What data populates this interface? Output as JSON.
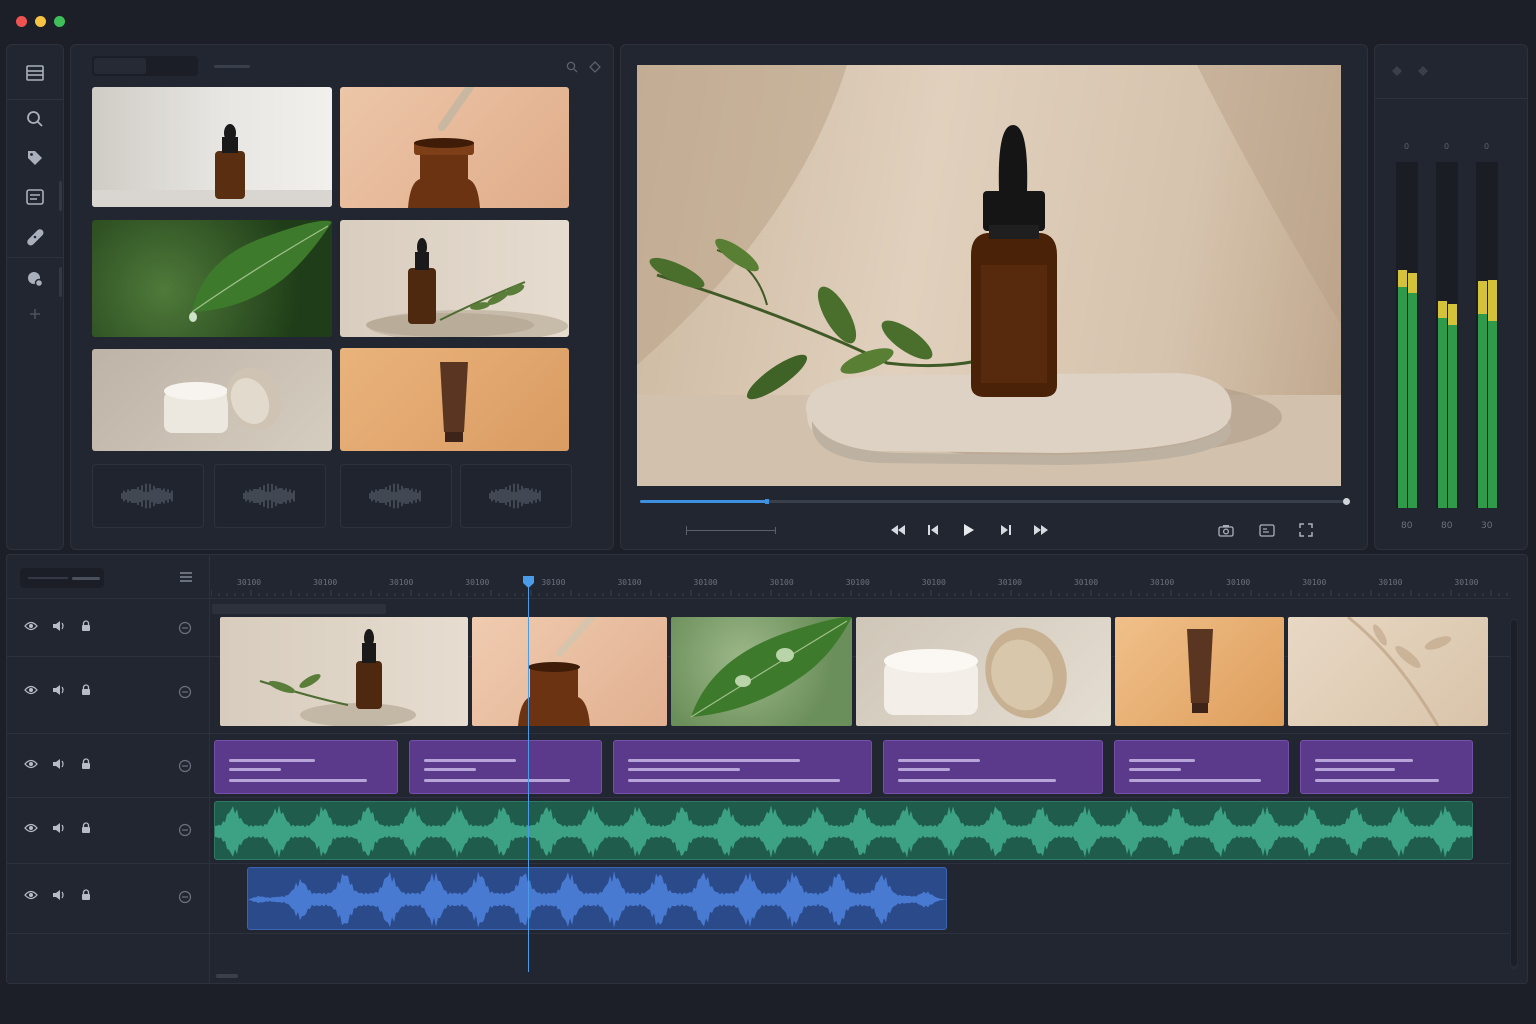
{
  "window": {
    "controls": [
      "close",
      "minimize",
      "maximize"
    ]
  },
  "left_toolbar": {
    "icons": [
      "menu-icon",
      "search-icon",
      "tag-icon",
      "captions-icon",
      "bandage-icon",
      "color-wheel-icon",
      "add-icon"
    ]
  },
  "media_browser": {
    "thumbnails": [
      "serum bottle on white",
      "dropper over bottle",
      "leaf with droplet",
      "serum bottle on stone",
      "cream jar",
      "brown tube"
    ],
    "audio_clips": 4
  },
  "viewer": {
    "progress": 0.18,
    "controls": [
      "rewind-icon",
      "step-back-icon",
      "play-icon",
      "step-forward-icon",
      "fast-forward-icon"
    ],
    "tools": [
      "snapshot-icon",
      "overlay-icon",
      "fullscreen-icon"
    ]
  },
  "audio_meters": {
    "scale_top": [
      "0",
      "0",
      "0"
    ],
    "scale_bottom": [
      "80",
      "80",
      "30"
    ],
    "levels": [
      {
        "green": 0.64,
        "yellow": 0.06
      },
      {
        "green": 0.55,
        "yellow": 0.06
      },
      {
        "green": 0.56,
        "yellow": 0.12
      }
    ],
    "colors": {
      "green": "#2f9a4a",
      "yellow": "#d4c23a"
    }
  },
  "timeline": {
    "ruler_labels": [
      "30100",
      "30100",
      "30100",
      "30100",
      "30100",
      "30100",
      "30100",
      "30100",
      "30100",
      "30100",
      "30100",
      "30100",
      "30100",
      "30100",
      "30100",
      "30100",
      "30100"
    ],
    "tracks": [
      "video-2",
      "video-1",
      "captions",
      "audio-music",
      "audio-voice"
    ],
    "track_icons": [
      "eye-icon",
      "speaker-icon",
      "lock-icon",
      "target-icon"
    ],
    "colors": {
      "captions": "#5b3a8c",
      "music": "#1f5c4c",
      "voice": "#2a4a8a",
      "playhead": "#4a9be8"
    }
  }
}
